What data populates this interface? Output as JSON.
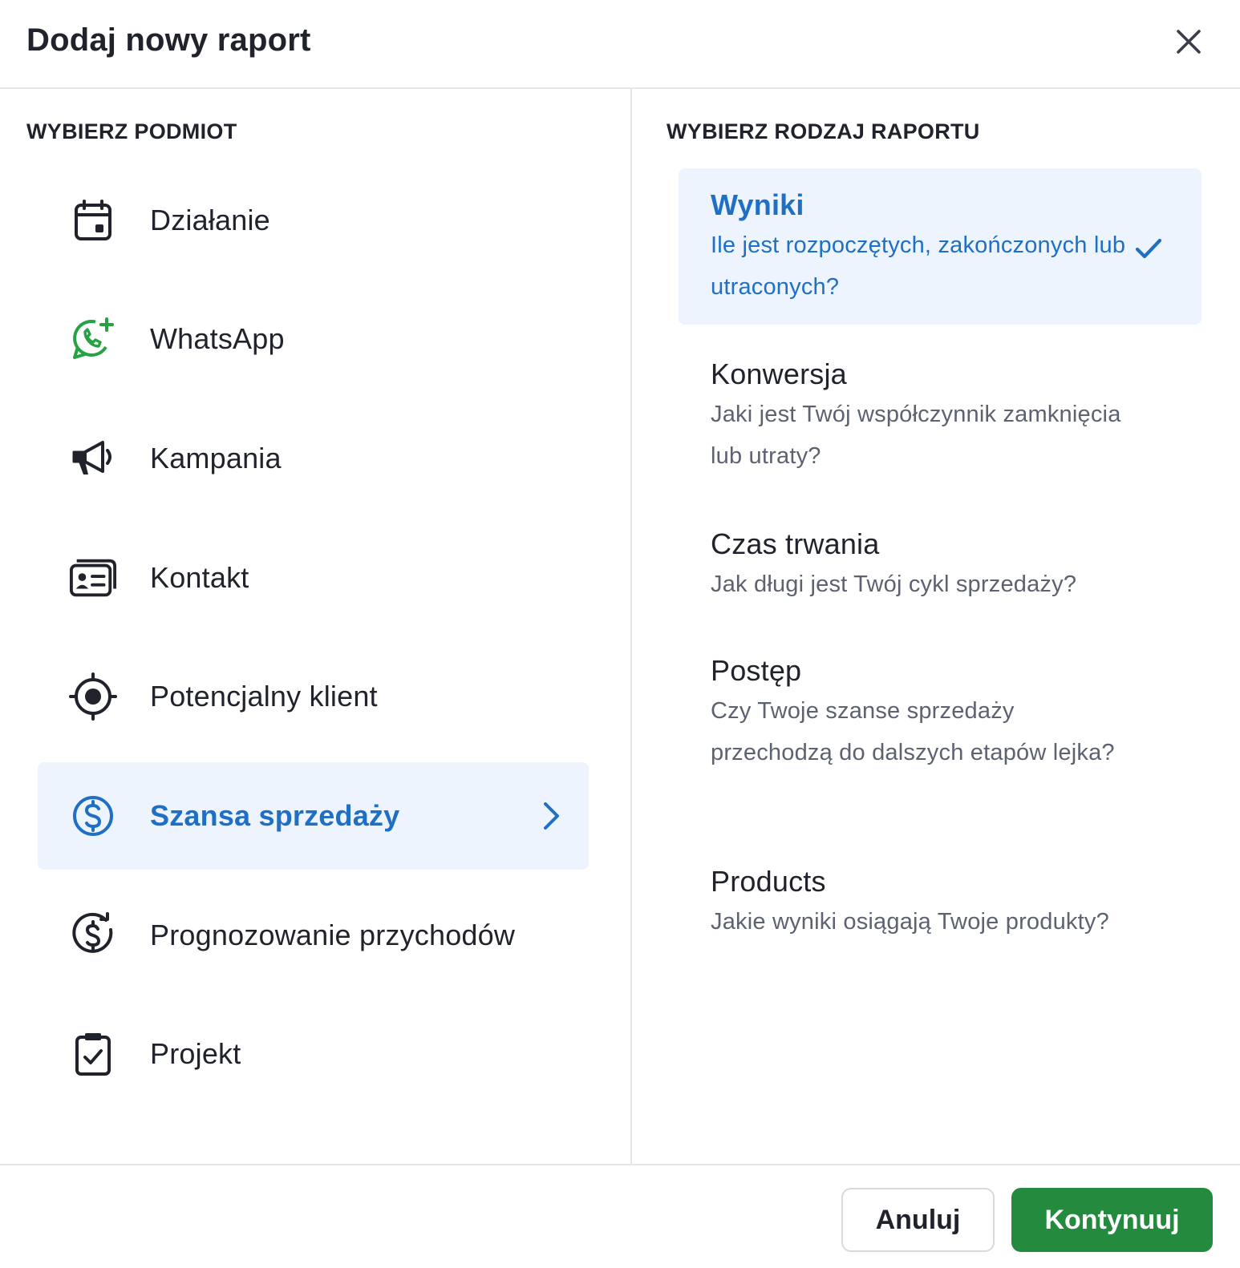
{
  "dialog": {
    "title": "Dodaj nowy raport",
    "close_icon": "close-icon"
  },
  "entities": {
    "heading": "WYBIERZ PODMIOT",
    "items": [
      {
        "label": "Działanie",
        "icon": "calendar-icon"
      },
      {
        "label": "WhatsApp",
        "icon": "whatsapp-icon",
        "icon_color": "#25a244"
      },
      {
        "label": "Kampania",
        "icon": "megaphone-icon"
      },
      {
        "label": "Kontakt",
        "icon": "contact-card-icon"
      },
      {
        "label": "Potencjalny klient",
        "icon": "target-icon"
      },
      {
        "label": "Szansa sprzedaży",
        "icon": "dollar-circle-icon",
        "selected": true,
        "trailing_icon": "chevron-right-icon"
      },
      {
        "label": "Prognozowanie przychodów",
        "icon": "dollar-refresh-icon"
      },
      {
        "label": "Projekt",
        "icon": "clipboard-check-icon"
      }
    ]
  },
  "report_types": {
    "heading": "WYBIERZ RODZAJ RAPORTU",
    "items": [
      {
        "name": "Wyniki",
        "description": "Ile jest rozpoczętych, zakończonych lub utraconych?",
        "selected": true,
        "trailing_icon": "check-icon"
      },
      {
        "name": "Konwersja",
        "description": "Jaki jest Twój współczynnik zamknięcia lub utraty?"
      },
      {
        "name": "Czas trwania",
        "description": "Jak długi jest Twój cykl sprzedaży?"
      },
      {
        "name": "Postęp",
        "description": "Czy Twoje szanse sprzedaży przechodzą do dalszych etapów lejka?"
      },
      {
        "name": "Products",
        "description": "Jakie wyniki osiągają Twoje produkty?"
      }
    ]
  },
  "footer": {
    "cancel_label": "Anuluj",
    "continue_label": "Kontynuuj"
  },
  "colors": {
    "accent": "#1f6fc5",
    "selected_bg": "#eef4fd",
    "primary_button": "#238a3e"
  }
}
